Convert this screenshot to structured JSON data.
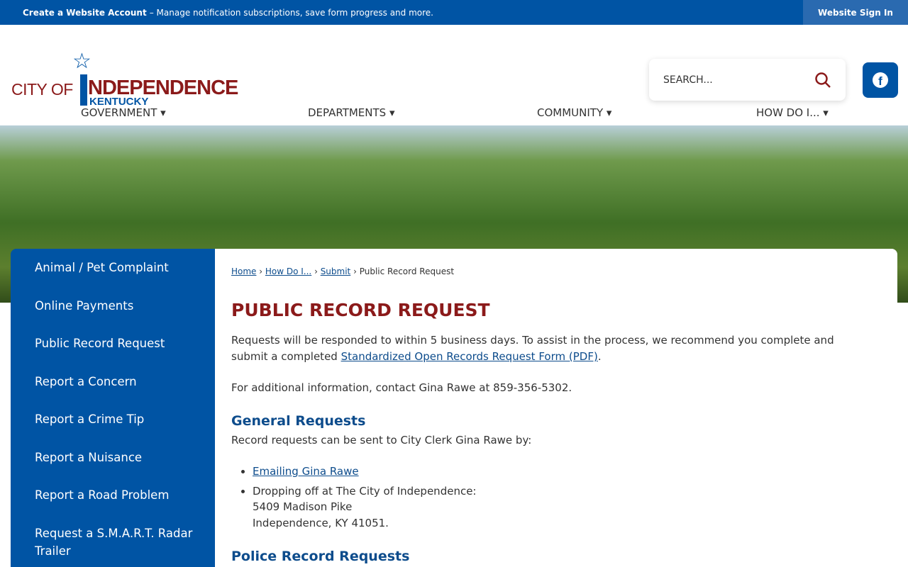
{
  "topbar": {
    "create_label": "Create a Website Account",
    "create_desc": "– Manage notification subscriptions, save form progress and more.",
    "signin": "Website Sign In"
  },
  "logo": {
    "city": "CITY OF",
    "name": "NDEPENDENCE",
    "state": "KENTUCKY"
  },
  "search": {
    "placeholder": "SEARCH..."
  },
  "nav": [
    "GOVERNMENT ▾",
    "DEPARTMENTS ▾",
    "COMMUNITY ▾",
    "HOW DO I... ▾"
  ],
  "sidebar": [
    "Animal / Pet Complaint",
    "Online Payments",
    "Public Record Request",
    "Report a Concern",
    "Report a Crime Tip",
    "Report a Nuisance",
    "Report a Road Problem",
    "Request a S.M.A.R.T. Radar Trailer"
  ],
  "breadcrumb": {
    "home": "Home",
    "howdoi": "How Do I...",
    "submit": "Submit",
    "current": "Public Record Request"
  },
  "content": {
    "title": "PUBLIC RECORD REQUEST",
    "intro": "Requests will be responded to within 5 business days. To assist in the process, we recommend you complete and submit a completed ",
    "intro_link": "Standardized Open Records Request Form (PDF)",
    "contact": "For additional information, contact Gina Rawe at 859-356-5302.",
    "general_heading": "General Requests",
    "general_text": "Record requests can be sent to City Clerk Gina Rawe by:",
    "email_link": "Emailing Gina Rawe",
    "dropoff": "Dropping off at The City of Independence:",
    "address1": "5409 Madison Pike",
    "address2": "Independence, KY 41051.",
    "police_heading": "Police Record Requests"
  }
}
